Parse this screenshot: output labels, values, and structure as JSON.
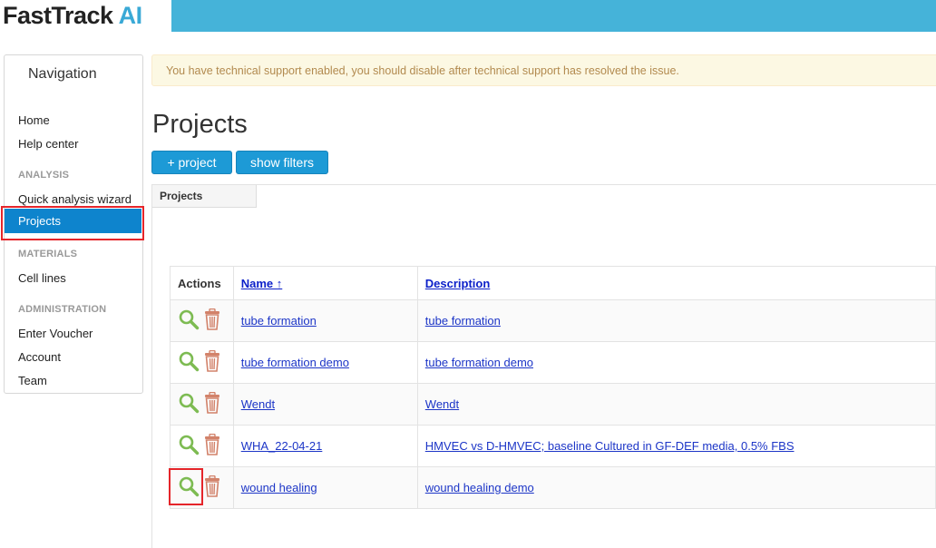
{
  "brand": {
    "name": "FastTrack",
    "ai": "AI",
    "tm": "™"
  },
  "colors": {
    "brand_bar": "#45b3d9",
    "active_nav": "#0e84cd",
    "button": "#1d9ad6",
    "link": "#1c35c7",
    "magnifier": "#7dbb52",
    "trash": "#d2826a",
    "highlight": "#e5252a"
  },
  "sidebar": {
    "title": "Navigation",
    "items": [
      {
        "label": "Home"
      },
      {
        "label": "Help center"
      }
    ],
    "section_analysis": "ANALYSIS",
    "analysis_items": [
      {
        "label": "Quick analysis wizard"
      },
      {
        "label": "Projects",
        "active": true
      }
    ],
    "section_materials": "MATERIALS",
    "materials_items": [
      {
        "label": "Cell lines"
      }
    ],
    "section_admin": "ADMINISTRATION",
    "admin_items": [
      {
        "label": "Enter Voucher"
      },
      {
        "label": "Account"
      },
      {
        "label": "Team"
      }
    ]
  },
  "alert": {
    "text": "You have technical support enabled, you should disable after technical support has resolved the issue."
  },
  "page": {
    "title": "Projects"
  },
  "toolbar": {
    "add_label": "+ project",
    "filters_label": "show filters"
  },
  "tabs": [
    {
      "label": "Projects"
    }
  ],
  "table": {
    "headers": {
      "actions": "Actions",
      "name": "Name ↑",
      "description": "Description"
    },
    "rows": [
      {
        "name": "tube formation",
        "description": "tube formation"
      },
      {
        "name": "tube formation demo",
        "description": "tube formation demo"
      },
      {
        "name": "Wendt",
        "description": "Wendt"
      },
      {
        "name": "WHA_22-04-21",
        "description": "HMVEC vs D-HMVEC; baseline Cultured in GF-DEF media, 0.5% FBS"
      },
      {
        "name": "wound healing",
        "description": "wound healing demo"
      }
    ]
  },
  "icons": {
    "view": "magnifier-icon",
    "delete": "trash-icon"
  }
}
